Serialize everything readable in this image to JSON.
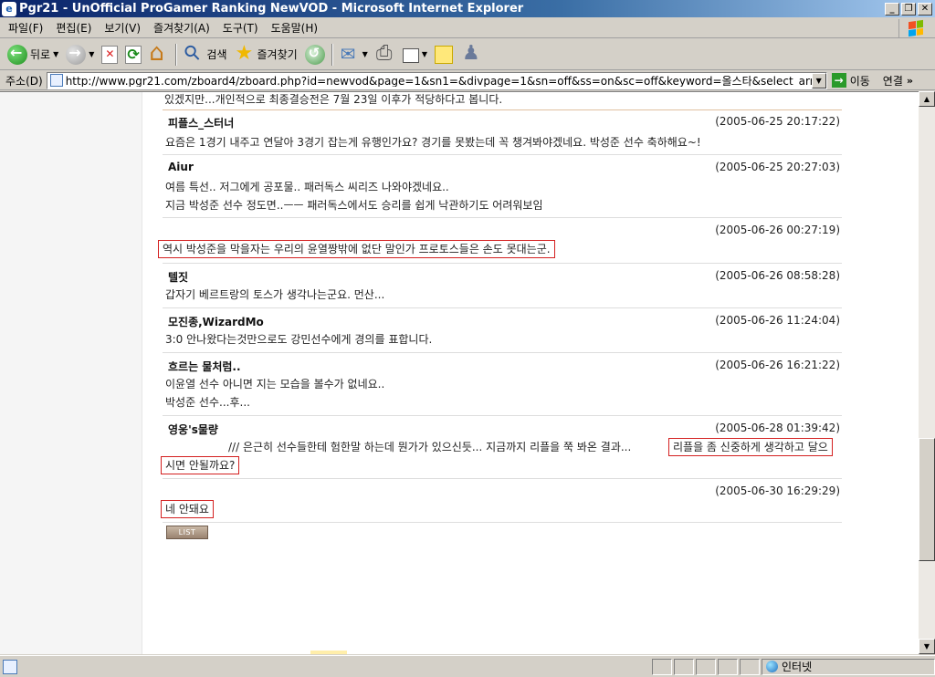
{
  "window": {
    "title": "Pgr21 - UnOfficial ProGamer Ranking NewVOD - Microsoft Internet Explorer",
    "controls": [
      "_",
      "❐",
      "✕"
    ]
  },
  "menu": [
    "파일(F)",
    "편집(E)",
    "보기(V)",
    "즐겨찾기(A)",
    "도구(T)",
    "도움말(H)"
  ],
  "toolbar": {
    "back_label": "뒤로",
    "search_label": "검색",
    "favorites_label": "즐겨찾기"
  },
  "address": {
    "label": "주소(D)",
    "url": "http://www.pgr21.com/zboard4/zboard.php?id=newvod&page=1&sn1=&divpage=1&sn=off&ss=on&sc=off&keyword=올스타&select_arrange=headnum",
    "go_label": "이동",
    "links_label": "연결"
  },
  "page": {
    "truncated_line": "있겠지만...개인적으로 최종결승전은 7월 23일 이후가 적당하다고 봅니다.",
    "comments": [
      {
        "author": "피플스_스터너",
        "date": "(2005-06-25 20:17:22)",
        "lines": [
          "요즘은 1경기 내주고 연달아 3경기 잡는게 유행인가요? 경기를 못봤는데 꼭 챙겨봐야겠네요. 박성준 선수 축하해요~!"
        ]
      },
      {
        "author": "Aiur",
        "date": "(2005-06-25 20:27:03)",
        "lines": [
          "여름 특선.. 저그에게 공포물.. 패러독스 씨리즈 나와야겠네요..",
          "지금 박성준 선수 정도면..ㅡㅡ 패러독스에서도 승리를 쉽게 낙관하기도 어려워보임"
        ]
      },
      {
        "author": "",
        "date": "(2005-06-26 00:27:19)",
        "lines": [
          "역시 박성준을 막을자는 우리의 윤열짱밖에 없단 말인가 프로토스들은 손도 못대는군."
        ]
      },
      {
        "author": "텔짓",
        "date": "(2005-06-26 08:58:28)",
        "lines": [
          "갑자기 베르트랑의 토스가 생각나는군요. 먼산..."
        ]
      },
      {
        "author": "모진종,WizardMo",
        "date": "(2005-06-26 11:24:04)",
        "lines": [
          "3:0 안나왔다는것만으로도 강민선수에게 경의를 표합니다."
        ]
      },
      {
        "author": "흐르는 물처럼..",
        "date": "(2005-06-26 16:21:22)",
        "lines": [
          "이윤열 선수 아니면 지는 모습을 볼수가 없네요..",
          "박성준 선수...후..."
        ]
      },
      {
        "author": "영웅's물량",
        "date": "(2005-06-28 01:39:42)",
        "lines": [
          "/// 은근히 선수들한테 험한말 하는데 뭔가가 있으신듯... 지금까지 리플을 쭉 봐온 결과...",
          "리플을 좀 신중하게 생각하고 달으",
          "시면 안될까요?"
        ]
      },
      {
        "author": "",
        "date": "(2005-06-30 16:29:29)",
        "lines": [
          "네 안돼요"
        ]
      }
    ],
    "list_button": "LIST"
  },
  "status": {
    "zone_label": "인터넷"
  }
}
